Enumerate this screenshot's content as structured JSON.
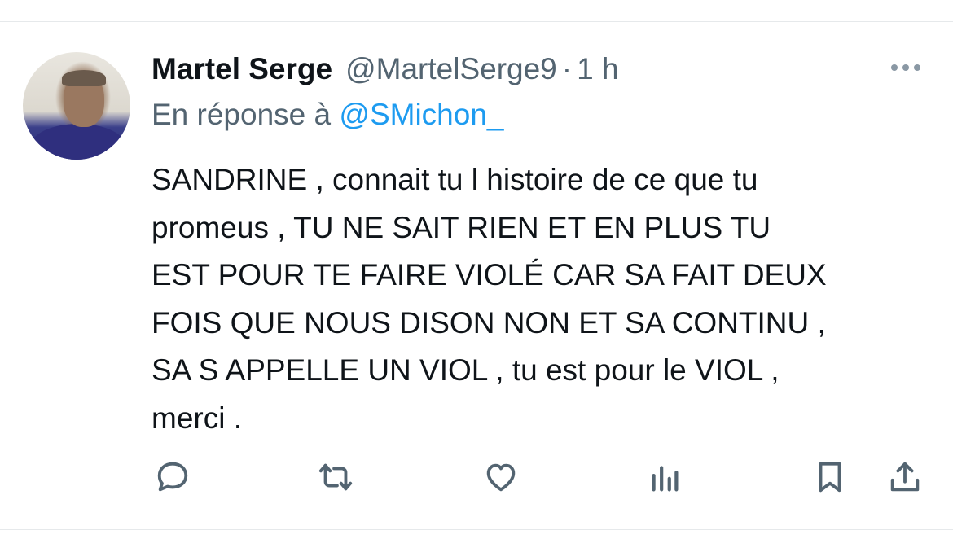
{
  "tweet": {
    "author_name": "Martel Serge",
    "author_handle": "@MartelSerge9",
    "separator": "·",
    "time": "1 h",
    "reply_prefix": "En réponse à",
    "reply_handle": "@SMichon_",
    "text": "SANDRINE , connait tu l histoire de ce que tu\npromeus , TU NE SAIT RIEN ET EN PLUS TU\nEST POUR TE FAIRE VIOLÉ CAR SA FAIT DEUX\nFOIS QUE NOUS DISON NON ET SA CONTINU ,\nSA S APPELLE UN VIOL , tu est pour le VIOL ,\nmerci ."
  },
  "colors": {
    "text_primary": "#0f1419",
    "text_secondary": "#536471",
    "link": "#1d9bf0",
    "icon": "#536471",
    "divider": "#e6e9eb"
  },
  "icons": {
    "more": "more-dots-icon",
    "reply": "reply-bubble-icon",
    "retweet": "retweet-icon",
    "like": "heart-icon",
    "views": "bar-chart-icon",
    "bookmark": "bookmark-icon",
    "share": "share-upload-icon"
  }
}
